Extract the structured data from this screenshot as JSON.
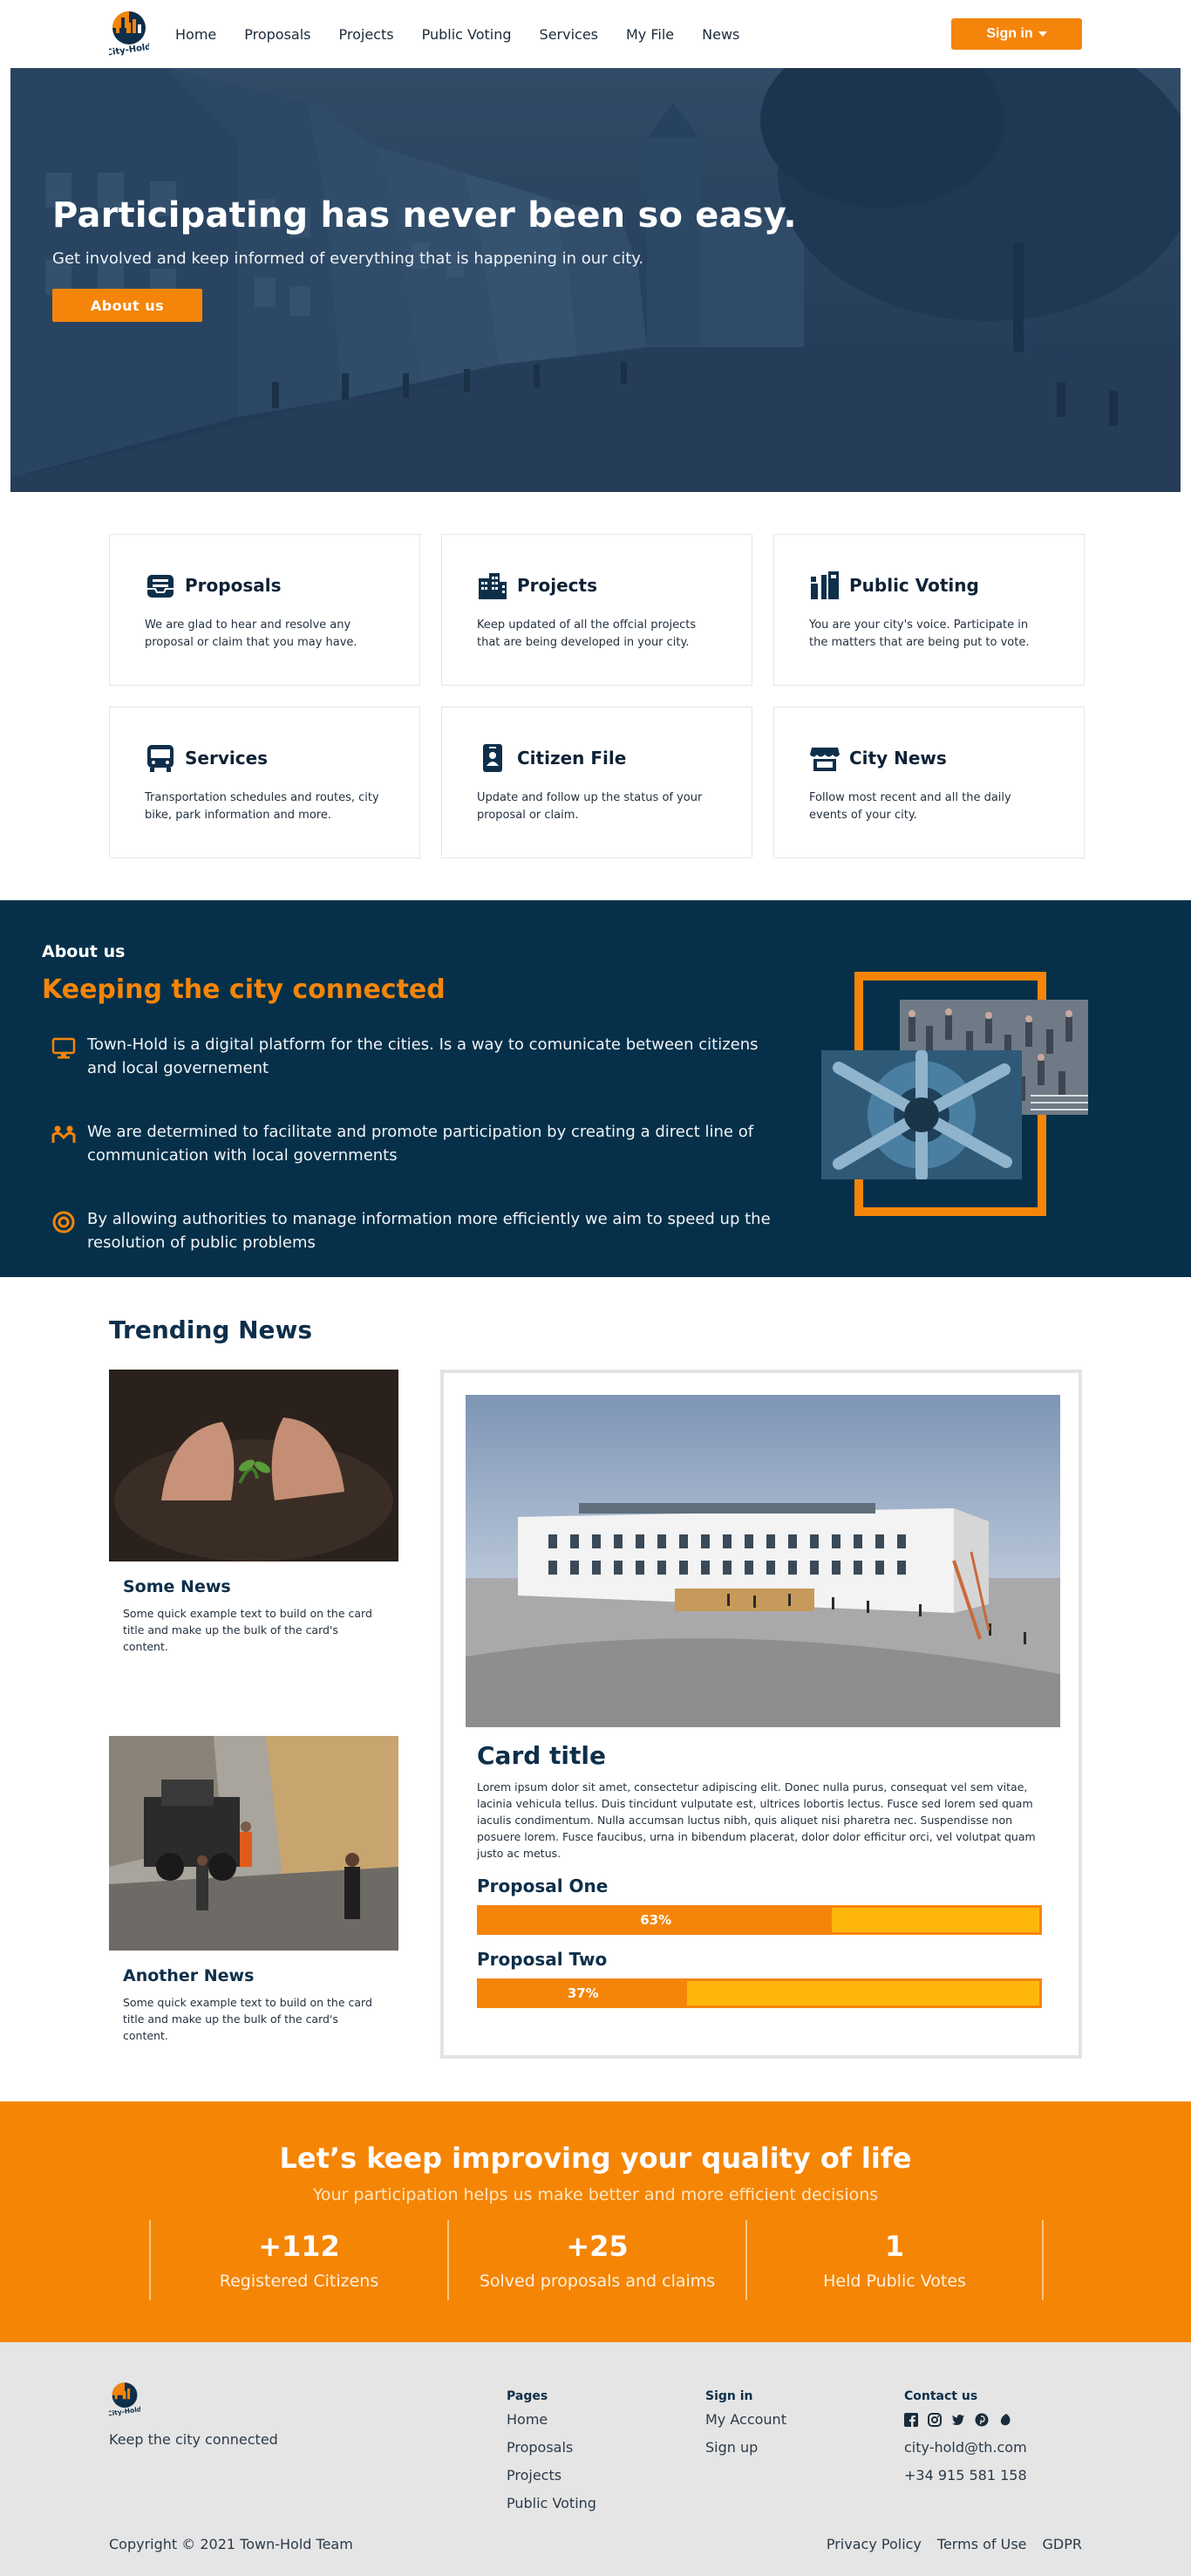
{
  "brand": {
    "name": "City-Hold",
    "accent": "#f5850a",
    "navy": "#063049"
  },
  "nav": {
    "links": [
      "Home",
      "Proposals",
      "Projects",
      "Public Voting",
      "Services",
      "My File",
      "News"
    ],
    "signin_label": "Sign in"
  },
  "hero": {
    "title": "Participating has never been so easy.",
    "subtitle": "Get involved and keep informed of everything that is happening in our city.",
    "button": "About us"
  },
  "services": [
    {
      "icon": "inbox-icon",
      "title": "Proposals",
      "text": "We are glad to hear and resolve any proposal or claim that you may have."
    },
    {
      "icon": "buildings-icon",
      "title": "Projects",
      "text": "Keep updated of all the offcial projects that are being developed in your city."
    },
    {
      "icon": "voting-icon",
      "title": "Public Voting",
      "text": "You are your city's voice. Participate in the matters that are being put to vote."
    },
    {
      "icon": "bus-icon",
      "title": "Services",
      "text": "Transportation schedules and routes, city bike, park information and more."
    },
    {
      "icon": "id-badge-icon",
      "title": "Citizen File",
      "text": "Update and follow up the status of your proposal or claim."
    },
    {
      "icon": "store-icon",
      "title": "City News",
      "text": "Follow most recent and all the daily events of your city."
    }
  ],
  "about": {
    "kicker": "About us",
    "title": "Keeping the city connected",
    "items": [
      {
        "icon": "monitor-icon",
        "text": "Town-Hold is a digital platform for the cities. Is a way to comunicate between citizens and local governement"
      },
      {
        "icon": "people-icon",
        "text": "We are determined to facilitate and promote participation by creating a direct line of communication with local governments"
      },
      {
        "icon": "target-icon",
        "text": "By allowing authorities to manage information more efficiently we aim to speed up the resolution of public problems"
      }
    ]
  },
  "trending": {
    "title": "Trending News",
    "news": [
      {
        "title": "Some News",
        "text": "Some quick example text to build on the card title and make up the bulk of the card's content."
      },
      {
        "title": "Another News",
        "text": "Some quick example text to build on the card title and make up the bulk of the card's content."
      }
    ],
    "feature": {
      "title": "Card title",
      "text": "Lorem ipsum dolor sit amet, consectetur adipiscing elit. Donec nulla purus, consequat vel sem vitae, lacinia vehicula tellus. Duis tincidunt vulputate est, ultrices lobortis lectus. Fusce sed lorem sed quam iaculis condimentum. Nulla accumsan luctus nibh, quis aliquet nisi pharetra nec. Suspendisse non posuere lorem. Fusce faucibus, urna in bibendum placerat, dolor dolor efficitur orci, vel volutpat quam justo ac metus.",
      "proposals": [
        {
          "label": "Proposal One",
          "percent": 63,
          "percent_text": "63%"
        },
        {
          "label": "Proposal Two",
          "percent": 37,
          "percent_text": "37%"
        }
      ]
    }
  },
  "stats": {
    "title": "Let’s keep improving your quality of life",
    "subtitle": "Your participation helps us make better and more efficient decisions",
    "items": [
      {
        "number": "+112",
        "label": "Registered Citizens"
      },
      {
        "number": "+25",
        "label": "Solved proposals and claims"
      },
      {
        "number": "1",
        "label": "Held Public Votes"
      }
    ]
  },
  "footer": {
    "tagline": "Keep the city connected",
    "pages": {
      "heading": "Pages",
      "links": [
        "Home",
        "Proposals",
        "Projects",
        "Public Voting"
      ]
    },
    "signin": {
      "heading": "Sign in",
      "links": [
        "My Account",
        "Sign up"
      ]
    },
    "contact": {
      "heading": "Contact us",
      "socials": [
        "facebook-icon",
        "instagram-icon",
        "twitter-icon",
        "pinterest-icon",
        "leaf-icon"
      ],
      "email": "city-hold@th.com",
      "phone": "+34 915 581 158"
    },
    "copyright": "Copyright © 2021 Town-Hold Team",
    "legal": [
      "Privacy Policy",
      "Terms of Use",
      "GDPR"
    ]
  }
}
